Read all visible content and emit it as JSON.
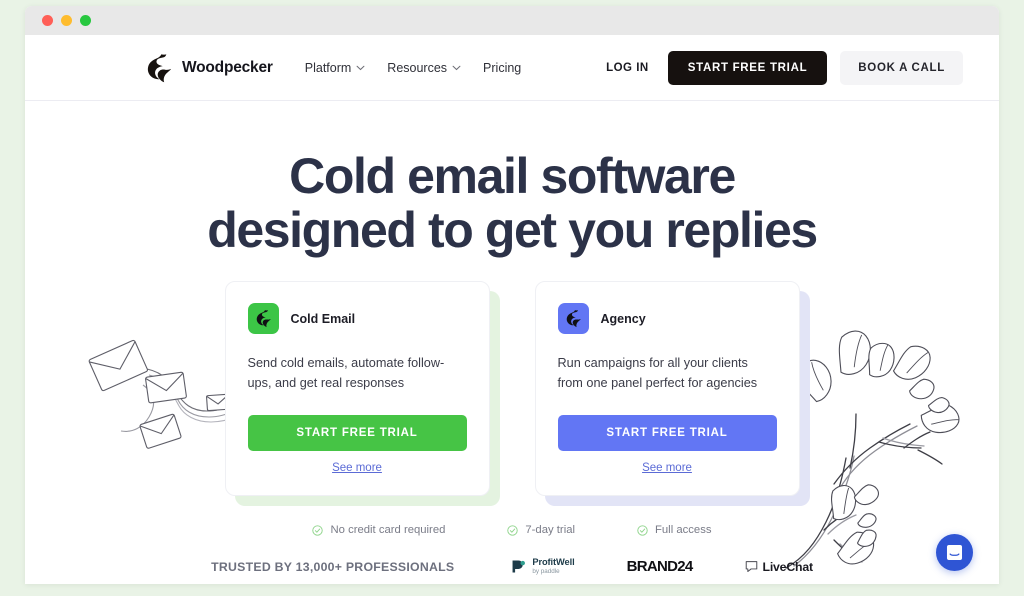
{
  "window": {
    "traffic_lights": [
      "close",
      "minimize",
      "maximize"
    ],
    "colors": {
      "close": "#ff5f57",
      "minimize": "#febc2e",
      "maximize": "#28c840"
    }
  },
  "header": {
    "brand": {
      "name": "Woodpecker",
      "logo_icon": "woodpecker-logo-icon"
    },
    "nav": [
      {
        "label": "Platform",
        "has_dropdown": true
      },
      {
        "label": "Resources",
        "has_dropdown": true
      },
      {
        "label": "Pricing",
        "has_dropdown": false
      }
    ],
    "login_label": "LOG IN",
    "primary_cta": "START FREE TRIAL",
    "secondary_cta": "BOOK A CALL"
  },
  "hero": {
    "headline_line1": "Cold email software",
    "headline_line2": "designed to get you replies",
    "headline_color": "#2c3248",
    "illustration_left": "envelopes-flow-illustration",
    "illustration_right": "tree-branch-leaves-illustration"
  },
  "cards": [
    {
      "id": "cold-email",
      "icon": "woodpecker-logo-icon",
      "icon_bg": "#3cc546",
      "title": "Cold Email",
      "description": "Send cold emails, automate follow-ups, and get real responses",
      "cta_label": "START FREE TRIAL",
      "cta_color": "#46c445",
      "link_label": "See more",
      "shadow_color": "#e4f3e0"
    },
    {
      "id": "agency",
      "icon": "woodpecker-logo-icon",
      "icon_bg": "#6276f4",
      "title": "Agency",
      "description": "Run campaigns for all your clients from one panel perfect for agencies",
      "cta_label": "START FREE TRIAL",
      "cta_color": "#6276f4",
      "link_label": "See more",
      "shadow_color": "#e2e4f6"
    }
  ],
  "badges": [
    {
      "icon": "check-circle-icon",
      "label": "No credit card required"
    },
    {
      "icon": "check-circle-icon",
      "label": "7-day trial"
    },
    {
      "icon": "check-circle-icon",
      "label": "Full access"
    }
  ],
  "trusted": {
    "label": "TRUSTED BY 13,000+ PROFESSIONALS",
    "logos": [
      {
        "id": "profitwell",
        "name": "ProfitWell",
        "tagline": "by paddle"
      },
      {
        "id": "brand24",
        "name": "BRAND24"
      },
      {
        "id": "livechat",
        "name": "LiveChat"
      }
    ]
  },
  "chat_widget": {
    "icon": "chat-message-icon",
    "color": "#2f55d4"
  }
}
